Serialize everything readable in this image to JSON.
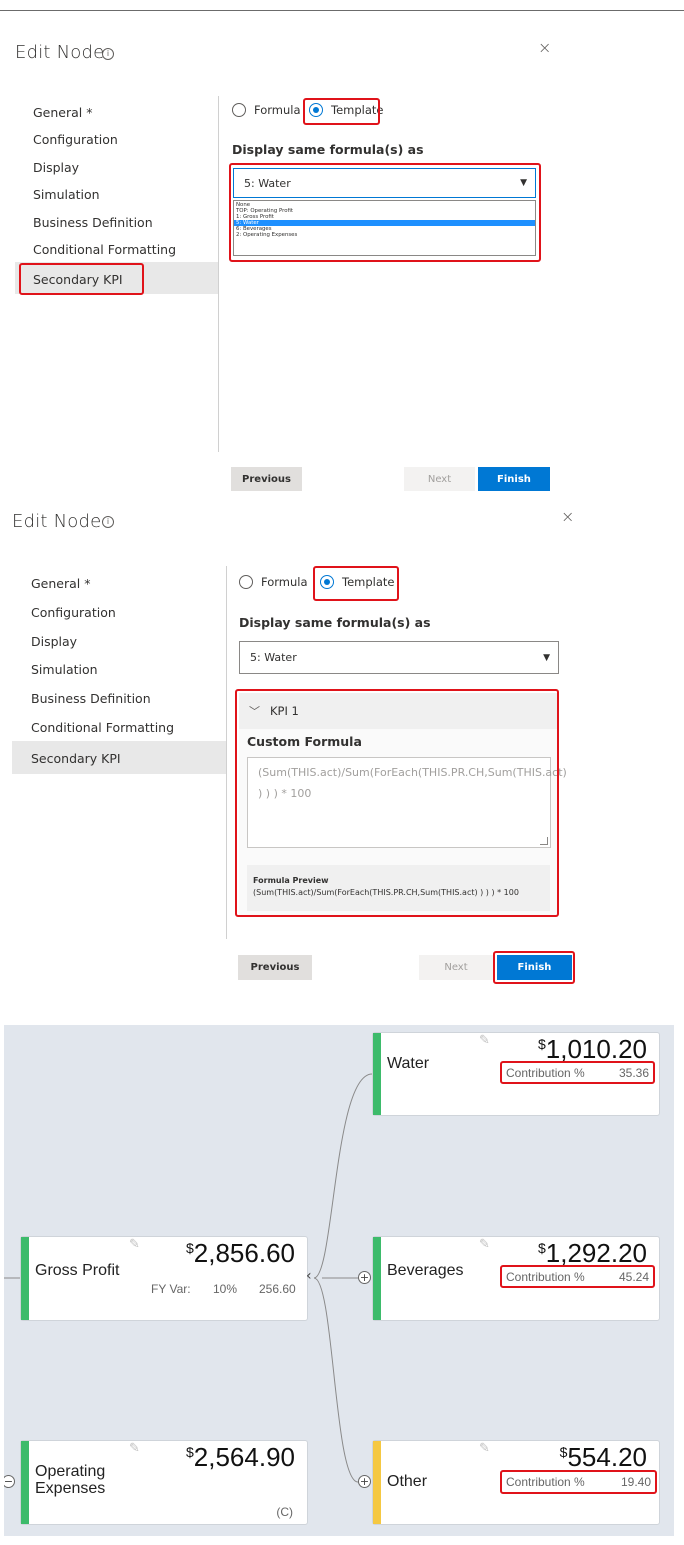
{
  "dialog": {
    "title": "Edit Node",
    "info_icon": "info-icon",
    "close_icon": "close-icon",
    "close_glyph": "×"
  },
  "nav": {
    "items": [
      "General *",
      "Configuration",
      "Display",
      "Simulation",
      "Business Definition",
      "Conditional Formatting",
      "Secondary KPI"
    ],
    "active": "Secondary KPI"
  },
  "mode": {
    "formula_label": "Formula",
    "template_label": "Template",
    "selected": "Template"
  },
  "template": {
    "label": "Display same formula(s) as",
    "selected_value": "5: Water",
    "caret": "▼",
    "options": [
      "None",
      "TOP: Operating Profit",
      "1: Gross Profit",
      "5: Water",
      "6: Beverages",
      "2: Operating Expenses"
    ]
  },
  "kpi": {
    "header": "KPI 1",
    "chevron_icon": "chevron-down-icon",
    "custom_formula_label": "Custom Formula",
    "custom_formula_placeholder": "(Sum(THIS.act)/Sum(ForEach(THIS.PR.CH,Sum(THIS.act) ) ) ) * 100",
    "preview_label": "Formula Preview",
    "preview_value": "(Sum(THIS.act)/Sum(ForEach(THIS.PR.CH,Sum(THIS.act) ) ) ) * 100"
  },
  "buttons": {
    "previous": "Previous",
    "next": "Next",
    "finish": "Finish"
  },
  "tree": {
    "currency": "$",
    "nodes": {
      "gross_profit": {
        "name": "Gross Profit",
        "value": "2,856.60",
        "var_label": "FY Var:",
        "var_pct": "10%",
        "var_value": "256.60",
        "color": "#3dbb6b"
      },
      "operating_expenses": {
        "name_line1": "Operating",
        "name_line2": "Expenses",
        "value": "2,564.90",
        "note": "(C)",
        "color": "#3dbb6b"
      },
      "water": {
        "name": "Water",
        "value": "1,010.20",
        "contrib_label": "Contribution %",
        "contrib_value": "35.36",
        "color": "#3dbb6b"
      },
      "beverages": {
        "name": "Beverages",
        "value": "1,292.20",
        "contrib_label": "Contribution %",
        "contrib_value": "45.24",
        "color": "#3dbb6b"
      },
      "other": {
        "name": "Other",
        "value": "554.20",
        "contrib_label": "Contribution %",
        "contrib_value": "19.40",
        "color": "#f5c842"
      }
    },
    "expand_glyph": "+",
    "collapse_glyph": "−",
    "back_glyph": "‹",
    "pencil_icon": "pencil-icon",
    "background": "#e1e6ed",
    "accent": "#0078d4",
    "highlight": "#e0131a"
  }
}
